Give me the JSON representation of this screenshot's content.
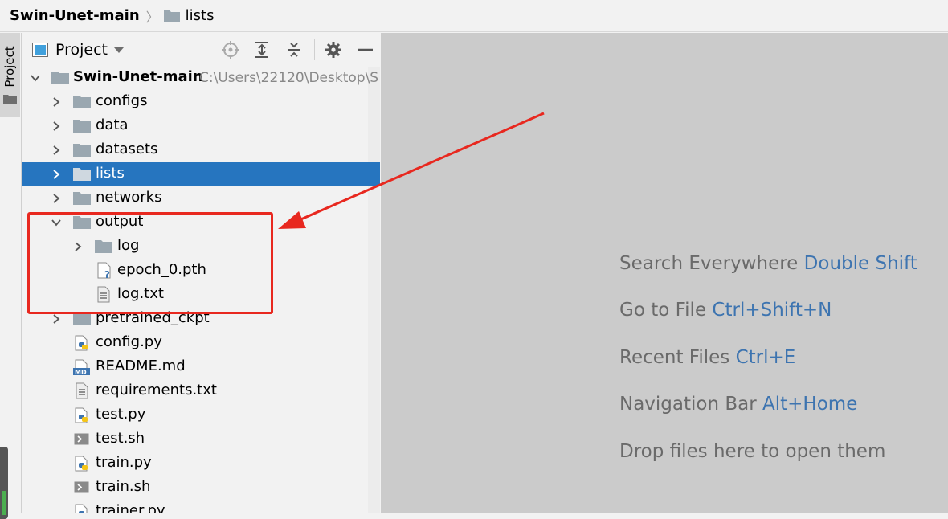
{
  "breadcrumb": {
    "root": "Swin-Unet-main",
    "current": "lists"
  },
  "toolstrip": {
    "project_tab": "Project"
  },
  "panel": {
    "title": "Project"
  },
  "tree": {
    "root": {
      "name": "Swin-Unet-main",
      "path": "C:\\Users\\22120\\Desktop\\S"
    },
    "items": [
      {
        "label": "configs"
      },
      {
        "label": "data"
      },
      {
        "label": "datasets"
      },
      {
        "label": "lists"
      },
      {
        "label": "networks"
      },
      {
        "label": "output"
      },
      {
        "label": "log"
      },
      {
        "label": "epoch_0.pth"
      },
      {
        "label": "log.txt"
      },
      {
        "label": "pretrained_ckpt"
      },
      {
        "label": "config.py"
      },
      {
        "label": "README.md"
      },
      {
        "label": "requirements.txt"
      },
      {
        "label": "test.py"
      },
      {
        "label": "test.sh"
      },
      {
        "label": "train.py"
      },
      {
        "label": "train.sh"
      },
      {
        "label": "trainer.py"
      }
    ],
    "selected": "lists"
  },
  "editor_hints": [
    {
      "text": "Search Everywhere",
      "key": "Double Shift"
    },
    {
      "text": "Go to File",
      "key": "Ctrl+Shift+N"
    },
    {
      "text": "Recent Files",
      "key": "Ctrl+E"
    },
    {
      "text": "Navigation Bar",
      "key": "Alt+Home"
    },
    {
      "text": "Drop files here to open them",
      "key": ""
    }
  ],
  "colors": {
    "selection": "#2675bf",
    "annotation": "#e8281f",
    "hint_key": "#3d74b0",
    "editor_bg": "#cbcbcb"
  },
  "icons": {
    "folder": "folder-icon",
    "python": "python-file-icon",
    "markdown": "markdown-file-icon",
    "text": "text-file-icon",
    "shell": "shell-script-icon",
    "unknown": "unknown-file-icon"
  }
}
